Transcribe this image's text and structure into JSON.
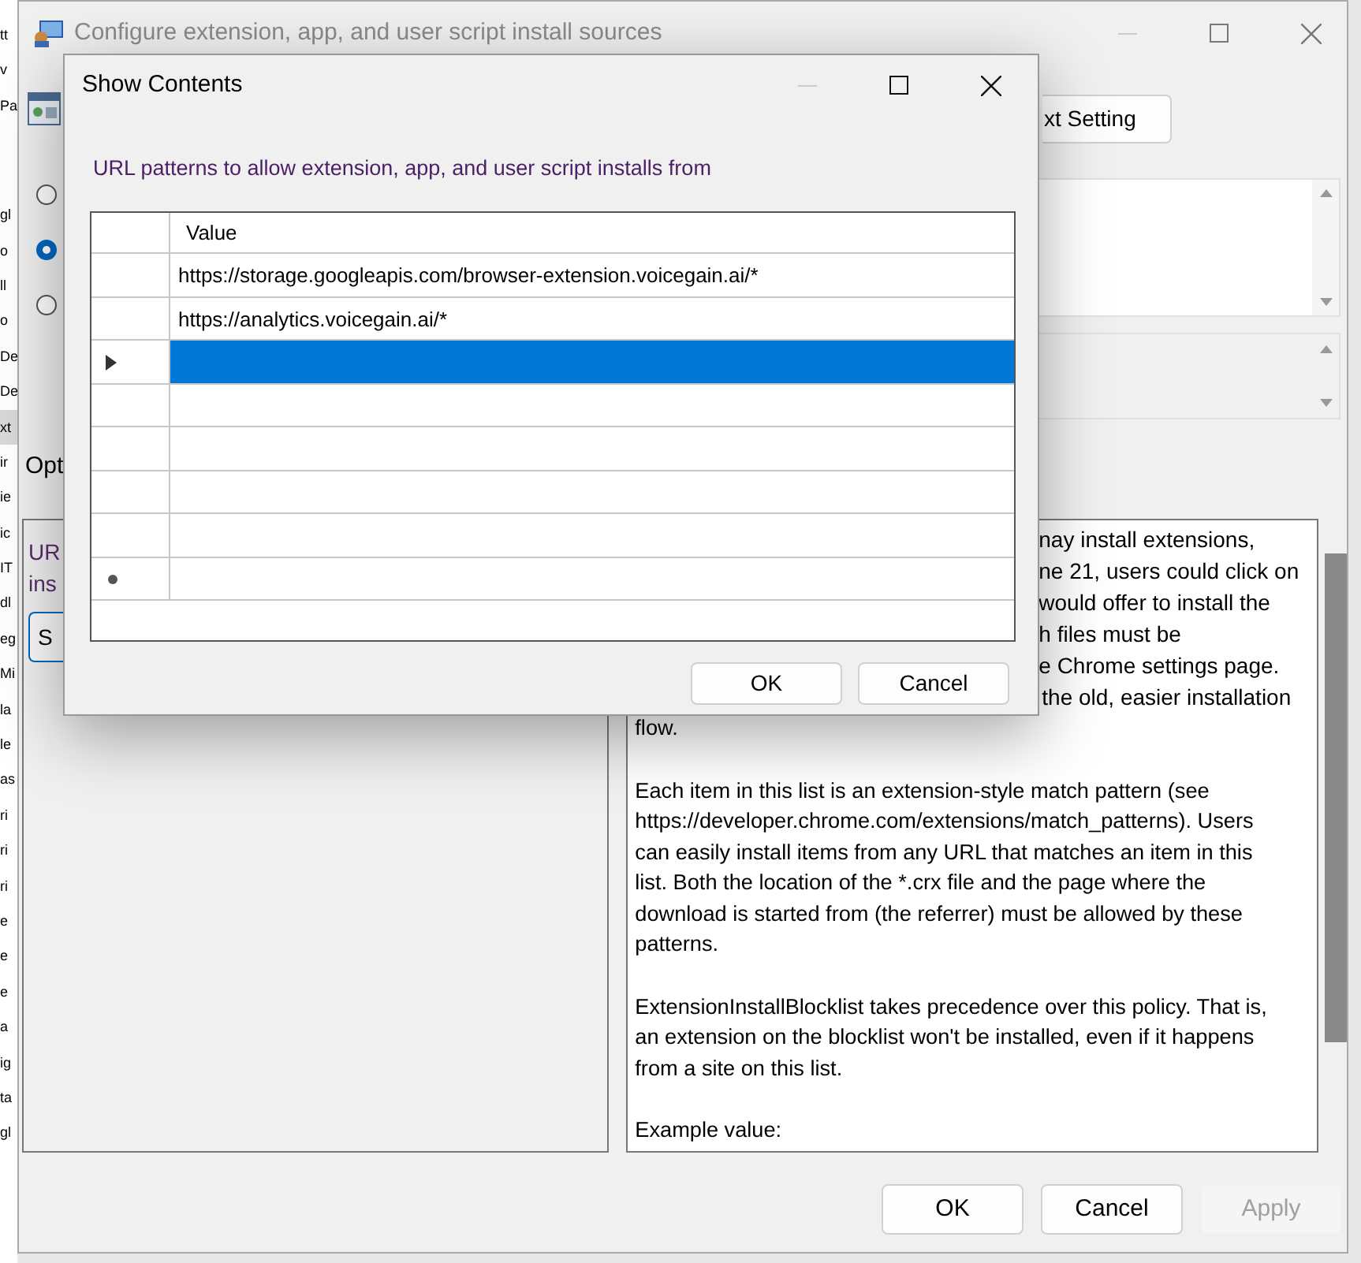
{
  "background_tree": {
    "items": [
      {
        "text": "tt",
        "selected": false
      },
      {
        "text": "v",
        "selected": false
      },
      {
        "text": "Pa",
        "selected": false
      },
      {
        "text": "gl",
        "selected": false
      },
      {
        "text": "o",
        "selected": false
      },
      {
        "text": "ll",
        "selected": false
      },
      {
        "text": "o",
        "selected": false
      },
      {
        "text": "De",
        "selected": false
      },
      {
        "text": "De",
        "selected": false
      },
      {
        "text": "xt",
        "selected": true
      },
      {
        "text": "ir",
        "selected": false
      },
      {
        "text": "ie",
        "selected": false
      },
      {
        "text": "ic",
        "selected": false
      },
      {
        "text": "IT",
        "selected": false
      },
      {
        "text": "dl",
        "selected": false
      },
      {
        "text": "eg",
        "selected": false
      },
      {
        "text": "Mi",
        "selected": false
      },
      {
        "text": "la",
        "selected": false
      },
      {
        "text": "le",
        "selected": false
      },
      {
        "text": "as",
        "selected": false
      },
      {
        "text": "ri",
        "selected": false
      },
      {
        "text": "ri",
        "selected": false
      },
      {
        "text": "ri",
        "selected": false
      },
      {
        "text": "e",
        "selected": false
      },
      {
        "text": "e",
        "selected": false
      },
      {
        "text": "e",
        "selected": false
      },
      {
        "text": "a",
        "selected": false
      },
      {
        "text": "ig",
        "selected": false
      },
      {
        "text": "ta",
        "selected": false
      },
      {
        "text": "gl",
        "selected": false
      }
    ]
  },
  "main_window": {
    "title": "Configure extension, app, and user script install sources",
    "next_setting_button": "xt Setting",
    "radios": [
      {
        "selected": false
      },
      {
        "selected": true
      },
      {
        "selected": false
      }
    ],
    "options_label": "Opt",
    "options_panel": {
      "lines": [
        "UR",
        "ins"
      ],
      "button": "S"
    },
    "help_partial_lines": [
      "nay install extensions,",
      "ne 21, users could click on",
      "would offer to install the",
      "h files must be",
      "e Chrome settings page.",
      "the old, easier installation"
    ],
    "help_paragraphs": [
      [
        "flow."
      ],
      [
        "Each item in this list is an extension-style match pattern (see",
        "https://developer.chrome.com/extensions/match_patterns). Users",
        "can easily install items from any URL that matches an item in this",
        "list. Both the location of the *.crx file and the page where the",
        "download is started from (the referrer) must be allowed by these",
        "patterns."
      ],
      [
        "ExtensionInstallBlocklist takes precedence over this policy. That is,",
        "an extension on the blocklist won't be installed, even if it happens",
        "from a site on this list."
      ],
      [
        "Example value:"
      ]
    ],
    "buttons": [
      {
        "label": "OK",
        "disabled": false
      },
      {
        "label": "Cancel",
        "disabled": false
      },
      {
        "label": "Apply",
        "disabled": true
      }
    ]
  },
  "dialog": {
    "title": "Show Contents",
    "label": "URL patterns to allow extension, app, and user script installs from",
    "columns": [
      "Value"
    ],
    "rows": [
      {
        "kind": "normal",
        "selected": false,
        "value": "https://storage.googleapis.com/browser-extension.voicegain.ai/*"
      },
      {
        "kind": "normal",
        "selected": false,
        "value": "https://analytics.voicegain.ai/*"
      },
      {
        "kind": "current",
        "selected": true
      },
      {
        "kind": "normal",
        "selected": false
      },
      {
        "kind": "normal",
        "selected": false
      },
      {
        "kind": "normal",
        "selected": false
      },
      {
        "kind": "normal",
        "selected": false
      },
      {
        "kind": "new",
        "selected": false
      }
    ],
    "buttons": [
      "OK",
      "Cancel"
    ]
  }
}
